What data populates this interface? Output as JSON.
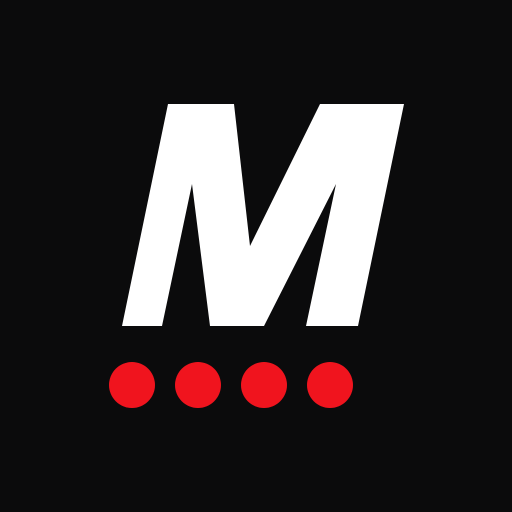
{
  "logo": {
    "letter": "M",
    "letter_color": "#ffffff",
    "background_color": "#0b0b0c",
    "dot_color": "#f0141e",
    "dot_count": 4
  }
}
